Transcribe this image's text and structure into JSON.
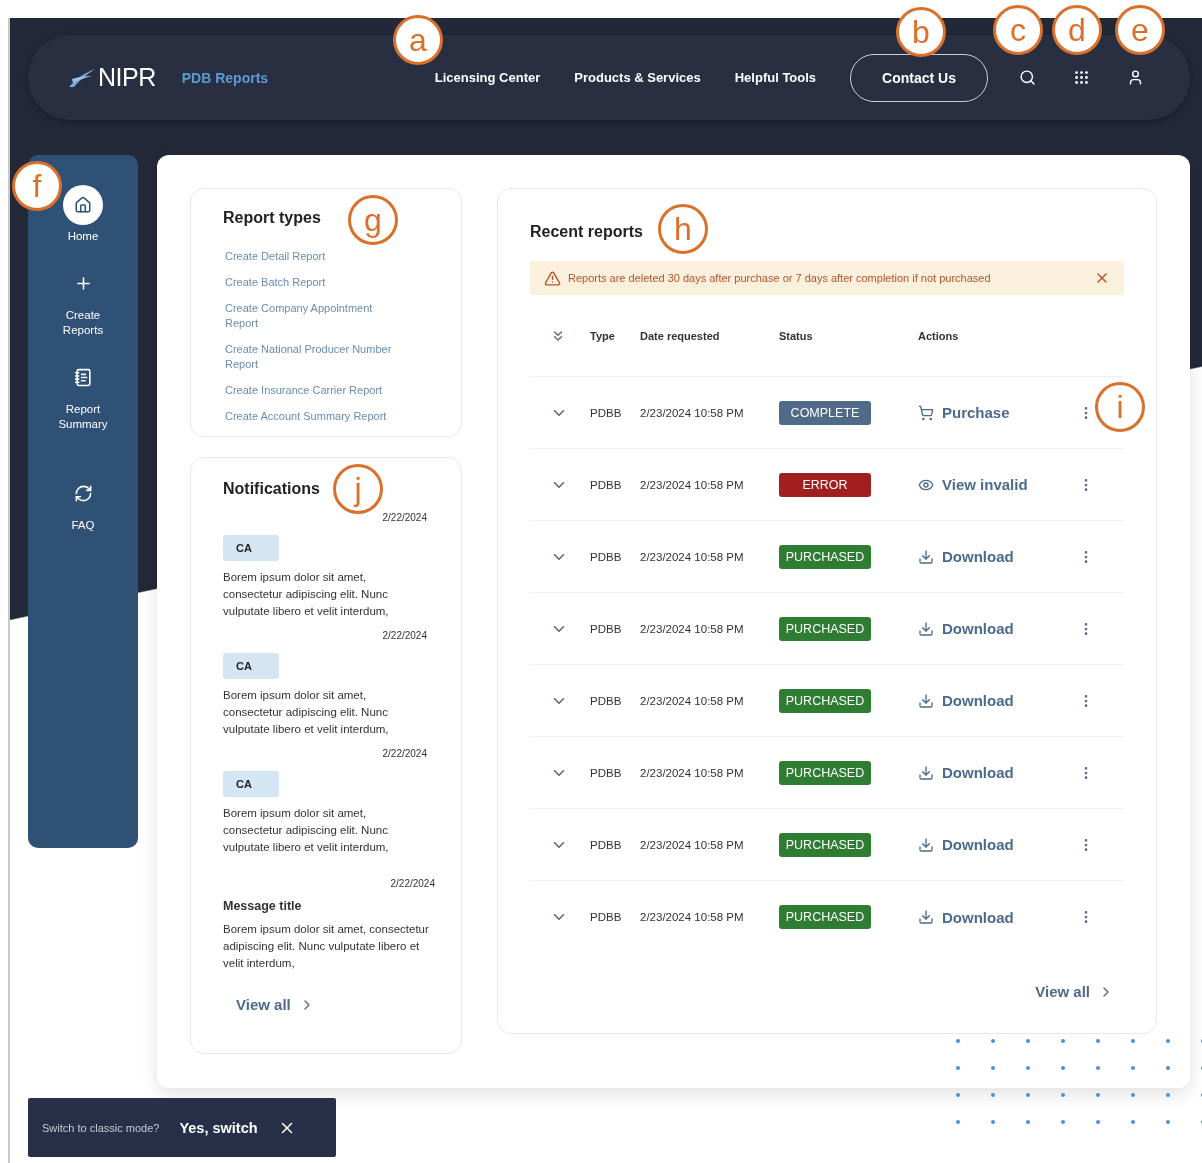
{
  "header": {
    "logo": "NIPR",
    "app_name": "PDB Reports",
    "nav": [
      {
        "label": "Licensing Center"
      },
      {
        "label": "Products & Services"
      },
      {
        "label": "Helpful Tools"
      }
    ],
    "contact_button": "Contact Us"
  },
  "sidebar": {
    "items": [
      {
        "label": "Home",
        "kind": "home",
        "selected": true
      },
      {
        "label": "Create Reports",
        "kind": "create",
        "selected": false
      },
      {
        "label": "Report Summary",
        "kind": "summary",
        "selected": false
      },
      {
        "label": "FAQ",
        "kind": "faq",
        "selected": false
      }
    ]
  },
  "report_types": {
    "title": "Report types",
    "links": [
      "Create Detail Report",
      "Create Batch Report",
      "Create Company Appointment Report",
      "Create National Producer Number Report",
      "Create Insurance Carrier Report",
      "Create Account Summary Report"
    ]
  },
  "notifications": {
    "title": "Notifications",
    "items": [
      {
        "kind": "tag",
        "date": "2/22/2024",
        "tag": "CA",
        "body": "Borem ipsum dolor sit amet, consectetur adipiscing elit. Nunc vulputate libero et velit interdum,"
      },
      {
        "kind": "tag",
        "date": "2/22/2024",
        "tag": "CA",
        "body": "Borem ipsum dolor sit amet, consectetur adipiscing elit. Nunc vulputate libero et velit interdum,"
      },
      {
        "kind": "tag",
        "date": "2/22/2024",
        "tag": "CA",
        "body": "Borem ipsum dolor sit amet, consectetur adipiscing elit. Nunc vulputate libero et velit interdum,"
      },
      {
        "kind": "message",
        "date": "2/22/2024",
        "title": "Message title",
        "body": "Borem ipsum dolor sit amet, consectetur adipiscing elit. Nunc vulputate libero et velit interdum,"
      }
    ],
    "view_all": "View all"
  },
  "recent_reports": {
    "title": "Recent reports",
    "alert": "Reports are deleted 30 days after purchase or 7 days after completion if not purchased",
    "columns": [
      "Type",
      "Date requested",
      "Status",
      "Actions"
    ],
    "rows": [
      {
        "type": "PDBB",
        "date": "2/23/2024 10:58 PM",
        "status": {
          "kind": "complete",
          "label": "COMPLETE"
        },
        "action": {
          "kind": "purchase",
          "label": "Purchase"
        }
      },
      {
        "type": "PDBB",
        "date": "2/23/2024 10:58 PM",
        "status": {
          "kind": "error",
          "label": "ERROR"
        },
        "action": {
          "kind": "view",
          "label": "View invalid"
        }
      },
      {
        "type": "PDBB",
        "date": "2/23/2024 10:58 PM",
        "status": {
          "kind": "purchased",
          "label": "PURCHASED"
        },
        "action": {
          "kind": "download",
          "label": "Download"
        }
      },
      {
        "type": "PDBB",
        "date": "2/23/2024 10:58 PM",
        "status": {
          "kind": "purchased",
          "label": "PURCHASED"
        },
        "action": {
          "kind": "download",
          "label": "Download"
        }
      },
      {
        "type": "PDBB",
        "date": "2/23/2024 10:58 PM",
        "status": {
          "kind": "purchased",
          "label": "PURCHASED"
        },
        "action": {
          "kind": "download",
          "label": "Download"
        }
      },
      {
        "type": "PDBB",
        "date": "2/23/2024 10:58 PM",
        "status": {
          "kind": "purchased",
          "label": "PURCHASED"
        },
        "action": {
          "kind": "download",
          "label": "Download"
        }
      },
      {
        "type": "PDBB",
        "date": "2/23/2024 10:58 PM",
        "status": {
          "kind": "purchased",
          "label": "PURCHASED"
        },
        "action": {
          "kind": "download",
          "label": "Download"
        }
      },
      {
        "type": "PDBB",
        "date": "2/23/2024 10:58 PM",
        "status": {
          "kind": "purchased",
          "label": "PURCHASED"
        },
        "action": {
          "kind": "download",
          "label": "Download"
        }
      }
    ],
    "view_all": "View all"
  },
  "toast": {
    "question": "Switch to classic mode?",
    "action": "Yes, switch"
  },
  "callouts": [
    "a",
    "b",
    "c",
    "d",
    "e",
    "f",
    "g",
    "h",
    "i",
    "j"
  ]
}
